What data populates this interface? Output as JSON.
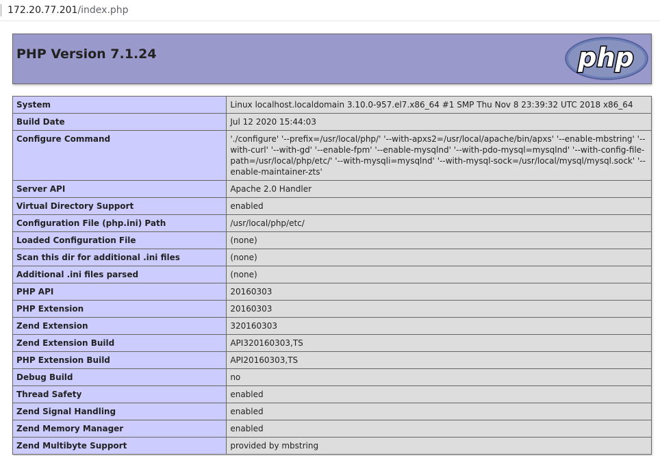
{
  "browser": {
    "url_host": "172.20.77.201",
    "url_path": "/index.php"
  },
  "header": {
    "title": "PHP Version 7.1.24",
    "logo_text": "php",
    "background_color": "#9999cc"
  },
  "colors": {
    "label_cell": "#ccccff",
    "value_cell": "#dddddd",
    "border": "#666666"
  },
  "rows": [
    {
      "label": "System",
      "value": "Linux localhost.localdomain 3.10.0-957.el7.x86_64 #1 SMP Thu Nov 8 23:39:32 UTC 2018 x86_64"
    },
    {
      "label": "Build Date",
      "value": "Jul 12 2020 15:44:03"
    },
    {
      "label": "Configure Command",
      "value": "'./configure' '--prefix=/usr/local/php/' '--with-apxs2=/usr/local/apache/bin/apxs' '--enable-mbstring' '--with-curl' '--with-gd' '--enable-fpm' '--enable-mysqlnd' '--with-pdo-mysql=mysqlnd' '--with-config-file-path=/usr/local/php/etc/' '--with-mysqli=mysqlnd' '--with-mysql-sock=/usr/local/mysql/mysql.sock' '--enable-maintainer-zts'"
    },
    {
      "label": "Server API",
      "value": "Apache 2.0 Handler"
    },
    {
      "label": "Virtual Directory Support",
      "value": "enabled"
    },
    {
      "label": "Configuration File (php.ini) Path",
      "value": "/usr/local/php/etc/"
    },
    {
      "label": "Loaded Configuration File",
      "value": "(none)"
    },
    {
      "label": "Scan this dir for additional .ini files",
      "value": "(none)"
    },
    {
      "label": "Additional .ini files parsed",
      "value": "(none)"
    },
    {
      "label": "PHP API",
      "value": "20160303"
    },
    {
      "label": "PHP Extension",
      "value": "20160303"
    },
    {
      "label": "Zend Extension",
      "value": "320160303"
    },
    {
      "label": "Zend Extension Build",
      "value": "API320160303,TS"
    },
    {
      "label": "PHP Extension Build",
      "value": "API20160303,TS"
    },
    {
      "label": "Debug Build",
      "value": "no"
    },
    {
      "label": "Thread Safety",
      "value": "enabled"
    },
    {
      "label": "Zend Signal Handling",
      "value": "enabled"
    },
    {
      "label": "Zend Memory Manager",
      "value": "enabled"
    },
    {
      "label": "Zend Multibyte Support",
      "value": "provided by mbstring"
    }
  ]
}
